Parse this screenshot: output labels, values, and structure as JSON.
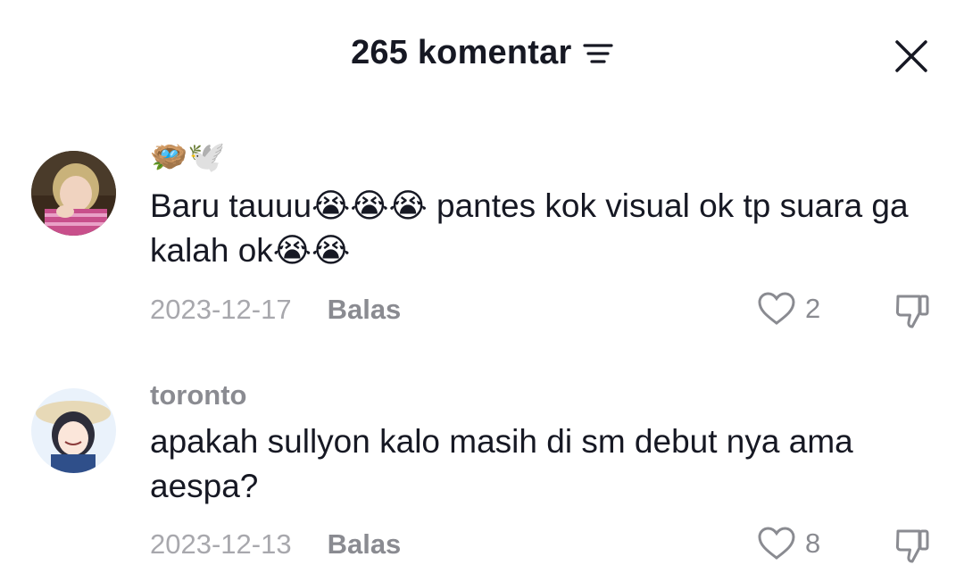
{
  "header": {
    "title": "265 komentar"
  },
  "comments": [
    {
      "username_emoji": "🪺🕊️",
      "text": "Baru tauuu😭😭😭 pantes kok visual ok tp suara ga kalah ok😭😭",
      "date": "2023-12-17",
      "reply_label": "Balas",
      "likes": "2"
    },
    {
      "username": "toronto",
      "text": "apakah sullyon kalo masih di sm debut nya ama aespa?",
      "date": "2023-12-13",
      "reply_label": "Balas",
      "likes": "8"
    }
  ],
  "icons": [
    "sort-icon",
    "close-icon",
    "heart-icon",
    "dislike-icon"
  ]
}
